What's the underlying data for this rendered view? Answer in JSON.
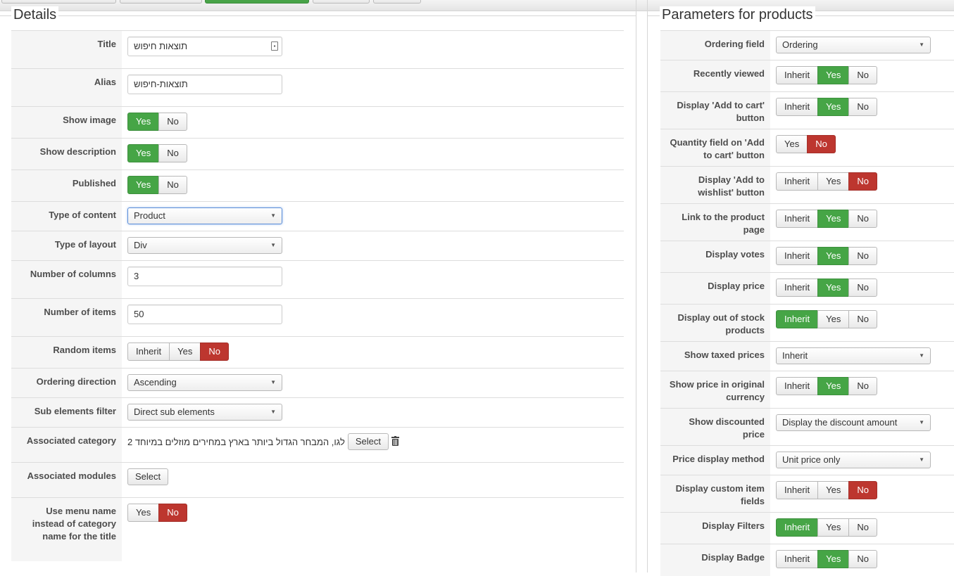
{
  "details": {
    "legend": "Details",
    "rows": {
      "title": {
        "label": "Title",
        "value": "תוצאות חיפוש"
      },
      "alias": {
        "label": "Alias",
        "value": "תוצאות-חיפוש"
      },
      "show_image": {
        "label": "Show image",
        "options": [
          "Yes",
          "No"
        ],
        "selected": "Yes"
      },
      "show_description": {
        "label": "Show description",
        "options": [
          "Yes",
          "No"
        ],
        "selected": "Yes"
      },
      "published": {
        "label": "Published",
        "options": [
          "Yes",
          "No"
        ],
        "selected": "Yes"
      },
      "type_of_content": {
        "label": "Type of content",
        "value": "Product"
      },
      "type_of_layout": {
        "label": "Type of layout",
        "value": "Div"
      },
      "number_of_columns": {
        "label": "Number of columns",
        "value": "3"
      },
      "number_of_items": {
        "label": "Number of items",
        "value": "50"
      },
      "random_items": {
        "label": "Random items",
        "options": [
          "Inherit",
          "Yes",
          "No"
        ],
        "selected": "No"
      },
      "ordering_direction": {
        "label": "Ordering direction",
        "value": "Ascending"
      },
      "sub_elements_filter": {
        "label": "Sub elements filter",
        "value": "Direct sub elements"
      },
      "associated_category": {
        "label": "Associated category",
        "value": "לגו, המבחר הגדול ביותר בארץ במחירים מוזלים במיוחד 2",
        "button": "Select"
      },
      "associated_modules": {
        "label": "Associated modules",
        "button": "Select"
      },
      "use_menu_name": {
        "label": "Use menu name instead of category name for the title",
        "options": [
          "Yes",
          "No"
        ],
        "selected": "No"
      }
    }
  },
  "parameters": {
    "legend": "Parameters for products",
    "rows": {
      "ordering_field": {
        "label": "Ordering field",
        "value": "Ordering"
      },
      "recently_viewed": {
        "label": "Recently viewed",
        "options": [
          "Inherit",
          "Yes",
          "No"
        ],
        "selected": "Yes"
      },
      "display_add_to_cart": {
        "label": "Display 'Add to cart' button",
        "options": [
          "Inherit",
          "Yes",
          "No"
        ],
        "selected": "Yes"
      },
      "quantity_field": {
        "label": "Quantity field on 'Add to cart' button",
        "options": [
          "Yes",
          "No"
        ],
        "selected": "No"
      },
      "display_add_to_wishlist": {
        "label": "Display 'Add to wishlist' button",
        "options": [
          "Inherit",
          "Yes",
          "No"
        ],
        "selected": "No"
      },
      "link_to_product_page": {
        "label": "Link to the product page",
        "options": [
          "Inherit",
          "Yes",
          "No"
        ],
        "selected": "Yes"
      },
      "display_votes": {
        "label": "Display votes",
        "options": [
          "Inherit",
          "Yes",
          "No"
        ],
        "selected": "Yes"
      },
      "display_price": {
        "label": "Display price",
        "options": [
          "Inherit",
          "Yes",
          "No"
        ],
        "selected": "Yes"
      },
      "display_out_of_stock": {
        "label": "Display out of stock products",
        "options": [
          "Inherit",
          "Yes",
          "No"
        ],
        "selected": "Inherit"
      },
      "show_taxed_prices": {
        "label": "Show taxed prices",
        "value": "Inherit"
      },
      "show_price_original_currency": {
        "label": "Show price in original currency",
        "options": [
          "Inherit",
          "Yes",
          "No"
        ],
        "selected": "Yes"
      },
      "show_discounted_price": {
        "label": "Show discounted price",
        "value": "Display the discount amount"
      },
      "price_display_method": {
        "label": "Price display method",
        "value": "Unit price only"
      },
      "display_custom_item_fields": {
        "label": "Display custom item fields",
        "options": [
          "Inherit",
          "Yes",
          "No"
        ],
        "selected": "No"
      },
      "display_filters": {
        "label": "Display Filters",
        "options": [
          "Inherit",
          "Yes",
          "No"
        ],
        "selected": "Inherit"
      },
      "display_badge": {
        "label": "Display Badge",
        "options": [
          "Inherit",
          "Yes",
          "No"
        ],
        "selected": "Yes"
      }
    }
  },
  "colors": {
    "yes_active": "#46a546",
    "no_active": "#bd362f"
  },
  "icons": {
    "title_field": "contact-card-icon",
    "category_remove": "trash-icon",
    "select_arrow": "chevron-down-icon"
  }
}
